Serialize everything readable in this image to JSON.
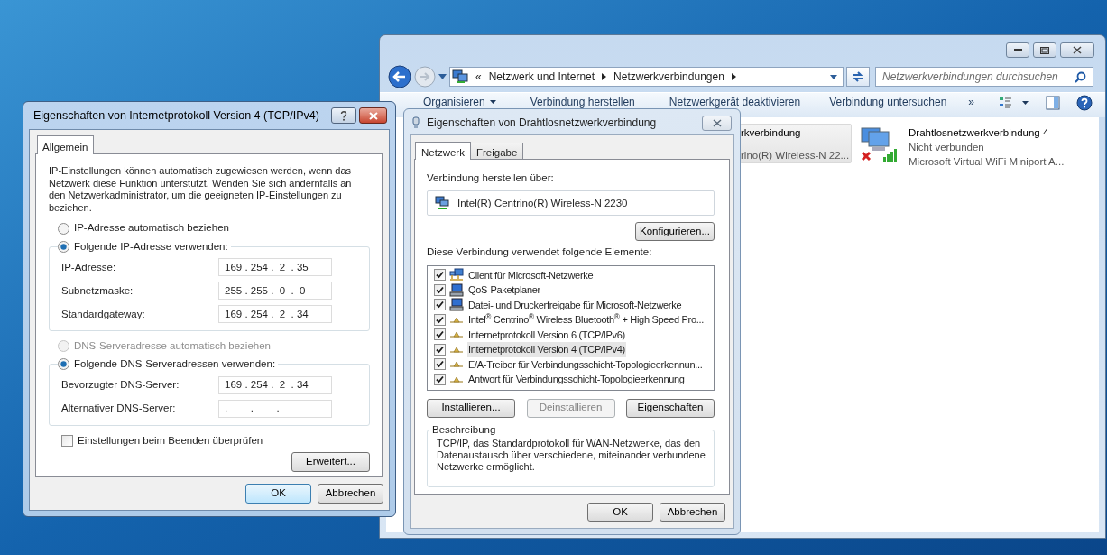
{
  "explorer": {
    "address": {
      "prefix": "«",
      "crumbs": [
        "Netzwerk und Internet",
        "Netzwerkverbindungen"
      ]
    },
    "search": {
      "placeholder": "Netzwerkverbindungen durchsuchen"
    },
    "toolbar": [
      {
        "label": "Organisieren",
        "dropdown": true
      },
      {
        "label": "Verbindung herstellen",
        "dropdown": false
      },
      {
        "label": "Netzwerkgerät deaktivieren",
        "dropdown": false
      },
      {
        "label": "Verbindung untersuchen",
        "dropdown": false
      },
      {
        "label": "»",
        "dropdown": false
      }
    ],
    "connections": [
      {
        "name": "rkverbindung",
        "device": "rino(R) Wireless-N 22...",
        "selected": true
      },
      {
        "name": "Drahtlosnetzwerkverbindung 4",
        "status": "Nicht verbunden",
        "device": "Microsoft Virtual WiFi Miniport A...",
        "selected": false,
        "connected": false
      }
    ]
  },
  "wireless_dialog": {
    "title": "Eigenschaften von Drahtlosnetzwerkverbindung",
    "tabs": [
      {
        "label": "Netzwerk",
        "selected": true
      },
      {
        "label": "Freigabe",
        "selected": false
      }
    ],
    "connect_via_label": "Verbindung herstellen über:",
    "adapter": "Intel(R) Centrino(R) Wireless-N 2230",
    "configure_button": "Konfigurieren...",
    "items_label": "Diese Verbindung verwendet folgende Elemente:",
    "items": [
      {
        "label": "Client für Microsoft-Netzwerke",
        "kind": "client",
        "checked": true,
        "selected": false
      },
      {
        "label": "QoS-Paketplaner",
        "kind": "computer",
        "checked": true,
        "selected": false
      },
      {
        "label": "Datei- und Druckerfreigabe für Microsoft-Netzwerke",
        "kind": "computer",
        "checked": true,
        "selected": false
      },
      {
        "label": "Intel$^{®}$ Centrino$^{®}$ Wireless Bluetooth$^{®}$ + High Speed Pro...",
        "kind": "protocol",
        "checked": true,
        "selected": false
      },
      {
        "label": "Internetprotokoll Version 6 (TCP/IPv6)",
        "kind": "protocol",
        "checked": true,
        "selected": false
      },
      {
        "label": "Internetprotokoll Version 4 (TCP/IPv4)",
        "kind": "protocol",
        "checked": true,
        "selected": true
      },
      {
        "label": "E/A-Treiber für Verbindungsschicht-Topologieerkennun...",
        "kind": "protocol",
        "checked": true,
        "selected": false
      },
      {
        "label": "Antwort für Verbindungsschicht-Topologieerkennung",
        "kind": "protocol",
        "checked": true,
        "selected": false
      }
    ],
    "buttons": [
      {
        "label": "Installieren...",
        "disabled": false
      },
      {
        "label": "Deinstallieren",
        "disabled": true
      },
      {
        "label": "Eigenschaften",
        "disabled": false
      }
    ],
    "description": {
      "title": "Beschreibung",
      "text": "TCP/IP, das Standardprotokoll für WAN-Netzwerke, das den Datenaustausch über verschiedene, miteinander verbundene Netzwerke ermöglicht."
    },
    "footer_buttons": [
      {
        "label": "OK",
        "default": false
      },
      {
        "label": "Abbrechen",
        "default": false
      }
    ]
  },
  "ipv4_dialog": {
    "title": "Eigenschaften von Internetprotokoll Version 4 (TCP/IPv4)",
    "tabs": [
      {
        "label": "Allgemein",
        "selected": true
      }
    ],
    "intro": "IP-Einstellungen können automatisch zugewiesen werden, wenn das Netzwerk diese Funktion unterstützt. Wenden Sie sich andernfalls an den Netzwerkadministrator, um die geeigneten IP-Einstellungen zu beziehen.",
    "ip_mode": [
      {
        "label": "IP-Adresse automatisch beziehen",
        "selected": false,
        "disabled": false
      },
      {
        "label": "Folgende IP-Adresse verwenden:",
        "selected": true,
        "disabled": false
      }
    ],
    "ip_fields": [
      {
        "label": "IP-Adresse:",
        "value": "169 . 254 .  2  . 35"
      },
      {
        "label": "Subnetzmaske:",
        "value": "255 . 255 .  0  .  0"
      },
      {
        "label": "Standardgateway:",
        "value": "169 . 254 .  2  . 34"
      }
    ],
    "dns_mode": [
      {
        "label": "DNS-Serveradresse automatisch beziehen",
        "selected": false,
        "disabled": true
      },
      {
        "label": "Folgende DNS-Serveradressen verwenden:",
        "selected": true,
        "disabled": false
      }
    ],
    "dns_fields": [
      {
        "label": "Bevorzugter DNS-Server:",
        "value": "169 . 254 .  2  . 34"
      },
      {
        "label": "Alternativer DNS-Server:",
        "value": ".        .        ."
      }
    ],
    "validate_checkbox": {
      "label": "Einstellungen beim Beenden überprüfen",
      "checked": false
    },
    "advanced_button": "Erweitert...",
    "footer_buttons": [
      {
        "label": "OK",
        "default": true
      },
      {
        "label": "Abbrechen",
        "default": false
      }
    ]
  }
}
